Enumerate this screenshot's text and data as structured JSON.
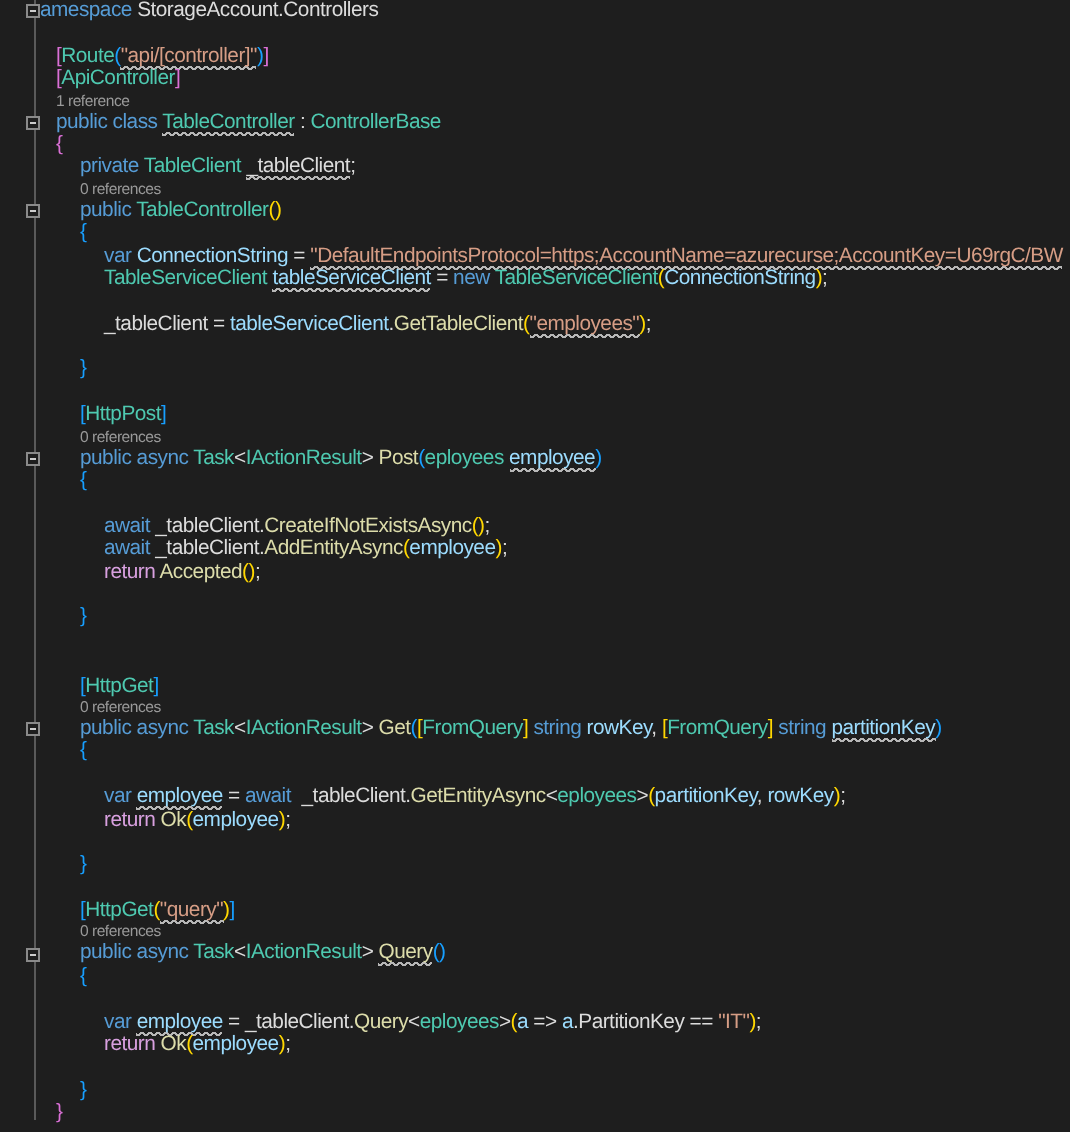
{
  "editor": {
    "lines": [
      {
        "kind": "code",
        "fold": true,
        "tokens": [
          {
            "text": "amespace",
            "kind": "keyword",
            "squiggle": false
          },
          {
            "text": " StorageAccount.Controllers",
            "kind": "plain",
            "squiggle": false
          }
        ],
        "children": [
          {
            "kind": "blank"
          },
          {
            "kind": "code",
            "fold": false,
            "tokens": [
              {
                "text": "[",
                "kind": "bracket2",
                "squiggle": false
              },
              {
                "text": "Route",
                "kind": "type",
                "squiggle": false
              },
              {
                "text": "(",
                "kind": "bracket3",
                "squiggle": false
              },
              {
                "text": "\"api/[controller]\"",
                "kind": "string",
                "squiggle": true
              },
              {
                "text": ")",
                "kind": "bracket3",
                "squiggle": false
              },
              {
                "text": "]",
                "kind": "bracket2",
                "squiggle": false
              }
            ]
          },
          {
            "kind": "code",
            "fold": false,
            "tokens": [
              {
                "text": "[",
                "kind": "bracket2",
                "squiggle": false
              },
              {
                "text": "ApiController",
                "kind": "type",
                "squiggle": false
              },
              {
                "text": "]",
                "kind": "bracket2",
                "squiggle": false
              }
            ]
          },
          {
            "kind": "lens",
            "text": "1 reference"
          },
          {
            "kind": "code",
            "fold": true,
            "tokens": [
              {
                "text": "public class ",
                "kind": "keyword",
                "squiggle": false
              },
              {
                "text": "TableController",
                "kind": "type",
                "squiggle": true
              },
              {
                "text": " : ",
                "kind": "plain",
                "squiggle": false
              },
              {
                "text": "ControllerBase",
                "kind": "type",
                "squiggle": false
              }
            ]
          },
          {
            "kind": "code",
            "fold": false,
            "tokens": [
              {
                "text": "{",
                "kind": "bracket2",
                "squiggle": false
              }
            ],
            "children": [
              {
                "kind": "code",
                "fold": false,
                "tokens": [
                  {
                    "text": "private ",
                    "kind": "keyword",
                    "squiggle": false
                  },
                  {
                    "text": "TableClient ",
                    "kind": "type",
                    "squiggle": false
                  },
                  {
                    "text": "_tableClient",
                    "kind": "plain",
                    "squiggle": true
                  },
                  {
                    "text": ";",
                    "kind": "plain",
                    "squiggle": false
                  }
                ]
              },
              {
                "kind": "lens",
                "text": "0 references"
              },
              {
                "kind": "code",
                "fold": true,
                "tokens": [
                  {
                    "text": "public ",
                    "kind": "keyword",
                    "squiggle": false
                  },
                  {
                    "text": "TableController",
                    "kind": "type",
                    "squiggle": false
                  },
                  {
                    "text": "()",
                    "kind": "bracket1",
                    "squiggle": false
                  }
                ]
              },
              {
                "kind": "code",
                "fold": false,
                "tokens": [
                  {
                    "text": "{",
                    "kind": "bracket3",
                    "squiggle": false
                  }
                ],
                "children": [
                  {
                    "kind": "code",
                    "fold": false,
                    "tokens": [
                      {
                        "text": "var ",
                        "kind": "keyword",
                        "squiggle": false
                      },
                      {
                        "text": "ConnectionString",
                        "kind": "variable",
                        "squiggle": false
                      },
                      {
                        "text": " = ",
                        "kind": "plain",
                        "squiggle": false
                      },
                      {
                        "text": "\"DefaultEndpointsProtocol=https;AccountName=azurecurse;AccountKey=U69rgC/BW",
                        "kind": "string",
                        "squiggle": true
                      }
                    ]
                  },
                  {
                    "kind": "code",
                    "fold": false,
                    "tokens": [
                      {
                        "text": "TableServiceClient ",
                        "kind": "type",
                        "squiggle": false
                      },
                      {
                        "text": "tableServiceClient",
                        "kind": "variable",
                        "squiggle": true
                      },
                      {
                        "text": " = ",
                        "kind": "plain",
                        "squiggle": false
                      },
                      {
                        "text": "new ",
                        "kind": "keyword",
                        "squiggle": false
                      },
                      {
                        "text": "TableServiceClient",
                        "kind": "type",
                        "squiggle": false
                      },
                      {
                        "text": "(",
                        "kind": "bracket1",
                        "squiggle": false
                      },
                      {
                        "text": "ConnectionString",
                        "kind": "variable",
                        "squiggle": false
                      },
                      {
                        "text": ")",
                        "kind": "bracket1",
                        "squiggle": false
                      },
                      {
                        "text": ";",
                        "kind": "plain",
                        "squiggle": false
                      }
                    ]
                  },
                  {
                    "kind": "blank"
                  },
                  {
                    "kind": "code",
                    "fold": false,
                    "tokens": [
                      {
                        "text": "_tableClient",
                        "kind": "plain",
                        "squiggle": false
                      },
                      {
                        "text": " = ",
                        "kind": "plain",
                        "squiggle": false
                      },
                      {
                        "text": "tableServiceClient",
                        "kind": "variable",
                        "squiggle": false
                      },
                      {
                        "text": ".",
                        "kind": "plain",
                        "squiggle": false
                      },
                      {
                        "text": "GetTableClient",
                        "kind": "method",
                        "squiggle": false
                      },
                      {
                        "text": "(",
                        "kind": "bracket1",
                        "squiggle": false
                      },
                      {
                        "text": "\"employees\"",
                        "kind": "string",
                        "squiggle": true
                      },
                      {
                        "text": ")",
                        "kind": "bracket1",
                        "squiggle": false
                      },
                      {
                        "text": ";",
                        "kind": "plain",
                        "squiggle": false
                      }
                    ]
                  },
                  {
                    "kind": "blank"
                  }
                ]
              },
              {
                "kind": "code",
                "fold": false,
                "tokens": [
                  {
                    "text": "}",
                    "kind": "bracket3",
                    "squiggle": false
                  }
                ]
              },
              {
                "kind": "blank"
              },
              {
                "kind": "code",
                "fold": false,
                "tokens": [
                  {
                    "text": "[",
                    "kind": "bracket3",
                    "squiggle": false
                  },
                  {
                    "text": "HttpPost",
                    "kind": "type",
                    "squiggle": false
                  },
                  {
                    "text": "]",
                    "kind": "bracket3",
                    "squiggle": false
                  }
                ]
              },
              {
                "kind": "lens",
                "text": "0 references"
              },
              {
                "kind": "code",
                "fold": true,
                "tokens": [
                  {
                    "text": "public async ",
                    "kind": "keyword",
                    "squiggle": false
                  },
                  {
                    "text": "Task",
                    "kind": "type",
                    "squiggle": false
                  },
                  {
                    "text": "<",
                    "kind": "plain",
                    "squiggle": false
                  },
                  {
                    "text": "IActionResult",
                    "kind": "type",
                    "squiggle": false
                  },
                  {
                    "text": "> ",
                    "kind": "plain",
                    "squiggle": false
                  },
                  {
                    "text": "Post",
                    "kind": "method",
                    "squiggle": false
                  },
                  {
                    "text": "(",
                    "kind": "bracket3",
                    "squiggle": false
                  },
                  {
                    "text": "eployees ",
                    "kind": "type",
                    "squiggle": false
                  },
                  {
                    "text": "employee",
                    "kind": "variable",
                    "squiggle": true
                  },
                  {
                    "text": ")",
                    "kind": "bracket3",
                    "squiggle": false
                  }
                ]
              },
              {
                "kind": "code",
                "fold": false,
                "tokens": [
                  {
                    "text": "{",
                    "kind": "bracket3",
                    "squiggle": false
                  }
                ],
                "children": [
                  {
                    "kind": "blank"
                  },
                  {
                    "kind": "code",
                    "fold": false,
                    "tokens": [
                      {
                        "text": "await ",
                        "kind": "keyword",
                        "squiggle": false
                      },
                      {
                        "text": "_tableClient.",
                        "kind": "plain",
                        "squiggle": false
                      },
                      {
                        "text": "CreateIfNotExistsAsync",
                        "kind": "method",
                        "squiggle": false
                      },
                      {
                        "text": "()",
                        "kind": "bracket1",
                        "squiggle": false
                      },
                      {
                        "text": ";",
                        "kind": "plain",
                        "squiggle": false
                      }
                    ]
                  },
                  {
                    "kind": "code",
                    "fold": false,
                    "tokens": [
                      {
                        "text": "await ",
                        "kind": "keyword",
                        "squiggle": false
                      },
                      {
                        "text": "_tableClient.",
                        "kind": "plain",
                        "squiggle": false
                      },
                      {
                        "text": "AddEntityAsync",
                        "kind": "method",
                        "squiggle": false
                      },
                      {
                        "text": "(",
                        "kind": "bracket1",
                        "squiggle": false
                      },
                      {
                        "text": "employee",
                        "kind": "variable",
                        "squiggle": false
                      },
                      {
                        "text": ")",
                        "kind": "bracket1",
                        "squiggle": false
                      },
                      {
                        "text": ";",
                        "kind": "plain",
                        "squiggle": false
                      }
                    ]
                  },
                  {
                    "kind": "code",
                    "fold": false,
                    "tokens": [
                      {
                        "text": "return ",
                        "kind": "control",
                        "squiggle": false
                      },
                      {
                        "text": "Accepted",
                        "kind": "method",
                        "squiggle": false
                      },
                      {
                        "text": "()",
                        "kind": "bracket1",
                        "squiggle": false
                      },
                      {
                        "text": ";",
                        "kind": "plain",
                        "squiggle": false
                      }
                    ]
                  },
                  {
                    "kind": "blank"
                  }
                ]
              },
              {
                "kind": "code",
                "fold": false,
                "tokens": [
                  {
                    "text": "}",
                    "kind": "bracket3",
                    "squiggle": false
                  }
                ]
              },
              {
                "kind": "blank"
              },
              {
                "kind": "blank"
              },
              {
                "kind": "code",
                "fold": false,
                "tokens": [
                  {
                    "text": "[",
                    "kind": "bracket3",
                    "squiggle": false
                  },
                  {
                    "text": "HttpGet",
                    "kind": "type",
                    "squiggle": false
                  },
                  {
                    "text": "]",
                    "kind": "bracket3",
                    "squiggle": false
                  }
                ]
              },
              {
                "kind": "lens",
                "text": "0 references"
              },
              {
                "kind": "code",
                "fold": true,
                "tokens": [
                  {
                    "text": "public async ",
                    "kind": "keyword",
                    "squiggle": false
                  },
                  {
                    "text": "Task",
                    "kind": "type",
                    "squiggle": false
                  },
                  {
                    "text": "<",
                    "kind": "plain",
                    "squiggle": false
                  },
                  {
                    "text": "IActionResult",
                    "kind": "type",
                    "squiggle": false
                  },
                  {
                    "text": "> ",
                    "kind": "plain",
                    "squiggle": false
                  },
                  {
                    "text": "Get",
                    "kind": "method",
                    "squiggle": false
                  },
                  {
                    "text": "(",
                    "kind": "bracket3",
                    "squiggle": false
                  },
                  {
                    "text": "[",
                    "kind": "bracket1",
                    "squiggle": false
                  },
                  {
                    "text": "FromQuery",
                    "kind": "type",
                    "squiggle": false
                  },
                  {
                    "text": "] ",
                    "kind": "bracket1",
                    "squiggle": false
                  },
                  {
                    "text": "string ",
                    "kind": "keyword",
                    "squiggle": false
                  },
                  {
                    "text": "rowKey",
                    "kind": "variable",
                    "squiggle": false
                  },
                  {
                    "text": ", ",
                    "kind": "plain",
                    "squiggle": false
                  },
                  {
                    "text": "[",
                    "kind": "bracket1",
                    "squiggle": false
                  },
                  {
                    "text": "FromQuery",
                    "kind": "type",
                    "squiggle": false
                  },
                  {
                    "text": "] ",
                    "kind": "bracket1",
                    "squiggle": false
                  },
                  {
                    "text": "string ",
                    "kind": "keyword",
                    "squiggle": false
                  },
                  {
                    "text": "partitionKey",
                    "kind": "variable",
                    "squiggle": true
                  },
                  {
                    "text": ")",
                    "kind": "bracket3",
                    "squiggle": false
                  }
                ]
              },
              {
                "kind": "code",
                "fold": false,
                "tokens": [
                  {
                    "text": "{",
                    "kind": "bracket3",
                    "squiggle": false
                  }
                ],
                "children": [
                  {
                    "kind": "blank"
                  },
                  {
                    "kind": "code",
                    "fold": false,
                    "tokens": [
                      {
                        "text": "var ",
                        "kind": "keyword",
                        "squiggle": false
                      },
                      {
                        "text": "employee",
                        "kind": "variable",
                        "squiggle": true
                      },
                      {
                        "text": " = ",
                        "kind": "plain",
                        "squiggle": false
                      },
                      {
                        "text": "await ",
                        "kind": "keyword",
                        "squiggle": false
                      },
                      {
                        "text": " _tableClient.",
                        "kind": "plain",
                        "squiggle": false
                      },
                      {
                        "text": "GetEntityAsync",
                        "kind": "method",
                        "squiggle": false
                      },
                      {
                        "text": "<",
                        "kind": "plain",
                        "squiggle": false
                      },
                      {
                        "text": "eployees",
                        "kind": "type",
                        "squiggle": false
                      },
                      {
                        "text": ">",
                        "kind": "plain",
                        "squiggle": false
                      },
                      {
                        "text": "(",
                        "kind": "bracket1",
                        "squiggle": false
                      },
                      {
                        "text": "partitionKey",
                        "kind": "variable",
                        "squiggle": false
                      },
                      {
                        "text": ", ",
                        "kind": "plain",
                        "squiggle": false
                      },
                      {
                        "text": "rowKey",
                        "kind": "variable",
                        "squiggle": false
                      },
                      {
                        "text": ")",
                        "kind": "bracket1",
                        "squiggle": false
                      },
                      {
                        "text": ";",
                        "kind": "plain",
                        "squiggle": false
                      }
                    ]
                  },
                  {
                    "kind": "code",
                    "fold": false,
                    "tokens": [
                      {
                        "text": "return ",
                        "kind": "control",
                        "squiggle": false
                      },
                      {
                        "text": "Ok",
                        "kind": "method",
                        "squiggle": false
                      },
                      {
                        "text": "(",
                        "kind": "bracket1",
                        "squiggle": false
                      },
                      {
                        "text": "employee",
                        "kind": "variable",
                        "squiggle": false
                      },
                      {
                        "text": ")",
                        "kind": "bracket1",
                        "squiggle": false
                      },
                      {
                        "text": ";",
                        "kind": "plain",
                        "squiggle": false
                      }
                    ]
                  },
                  {
                    "kind": "blank"
                  }
                ]
              },
              {
                "kind": "code",
                "fold": false,
                "tokens": [
                  {
                    "text": "}",
                    "kind": "bracket3",
                    "squiggle": false
                  }
                ]
              },
              {
                "kind": "blank"
              },
              {
                "kind": "code",
                "fold": false,
                "tokens": [
                  {
                    "text": "[",
                    "kind": "bracket3",
                    "squiggle": false
                  },
                  {
                    "text": "HttpGet",
                    "kind": "type",
                    "squiggle": false
                  },
                  {
                    "text": "(",
                    "kind": "bracket1",
                    "squiggle": false
                  },
                  {
                    "text": "\"query\"",
                    "kind": "string",
                    "squiggle": true
                  },
                  {
                    "text": ")",
                    "kind": "bracket1",
                    "squiggle": false
                  },
                  {
                    "text": "]",
                    "kind": "bracket3",
                    "squiggle": false
                  }
                ]
              },
              {
                "kind": "lens",
                "text": "0 references"
              },
              {
                "kind": "code",
                "fold": true,
                "tokens": [
                  {
                    "text": "public async ",
                    "kind": "keyword",
                    "squiggle": false
                  },
                  {
                    "text": "Task",
                    "kind": "type",
                    "squiggle": false
                  },
                  {
                    "text": "<",
                    "kind": "plain",
                    "squiggle": false
                  },
                  {
                    "text": "IActionResult",
                    "kind": "type",
                    "squiggle": false
                  },
                  {
                    "text": "> ",
                    "kind": "plain",
                    "squiggle": false
                  },
                  {
                    "text": "Query",
                    "kind": "method",
                    "squiggle": true
                  },
                  {
                    "text": "()",
                    "kind": "bracket3",
                    "squiggle": false
                  }
                ]
              },
              {
                "kind": "code",
                "fold": false,
                "tokens": [
                  {
                    "text": "{",
                    "kind": "bracket3",
                    "squiggle": false
                  }
                ],
                "children": [
                  {
                    "kind": "blank"
                  },
                  {
                    "kind": "code",
                    "fold": false,
                    "tokens": [
                      {
                        "text": "var ",
                        "kind": "keyword",
                        "squiggle": false
                      },
                      {
                        "text": "employee",
                        "kind": "variable",
                        "squiggle": true
                      },
                      {
                        "text": " = ",
                        "kind": "plain",
                        "squiggle": false
                      },
                      {
                        "text": "_tableClient.",
                        "kind": "plain",
                        "squiggle": false
                      },
                      {
                        "text": "Query",
                        "kind": "method",
                        "squiggle": false
                      },
                      {
                        "text": "<",
                        "kind": "plain",
                        "squiggle": false
                      },
                      {
                        "text": "eployees",
                        "kind": "type",
                        "squiggle": false
                      },
                      {
                        "text": ">",
                        "kind": "plain",
                        "squiggle": false
                      },
                      {
                        "text": "(",
                        "kind": "bracket1",
                        "squiggle": false
                      },
                      {
                        "text": "a",
                        "kind": "variable",
                        "squiggle": false
                      },
                      {
                        "text": " => ",
                        "kind": "plain",
                        "squiggle": false
                      },
                      {
                        "text": "a",
                        "kind": "variable",
                        "squiggle": false
                      },
                      {
                        "text": ".PartitionKey == ",
                        "kind": "plain",
                        "squiggle": false
                      },
                      {
                        "text": "\"IT\"",
                        "kind": "string",
                        "squiggle": false
                      },
                      {
                        "text": ")",
                        "kind": "bracket1",
                        "squiggle": false
                      },
                      {
                        "text": ";",
                        "kind": "plain",
                        "squiggle": false
                      }
                    ]
                  },
                  {
                    "kind": "code",
                    "fold": false,
                    "tokens": [
                      {
                        "text": "return ",
                        "kind": "control",
                        "squiggle": false
                      },
                      {
                        "text": "Ok",
                        "kind": "method",
                        "squiggle": false
                      },
                      {
                        "text": "(",
                        "kind": "bracket1",
                        "squiggle": false
                      },
                      {
                        "text": "employee",
                        "kind": "variable",
                        "squiggle": false
                      },
                      {
                        "text": ")",
                        "kind": "bracket1",
                        "squiggle": false
                      },
                      {
                        "text": ";",
                        "kind": "plain",
                        "squiggle": false
                      }
                    ]
                  },
                  {
                    "kind": "blank"
                  }
                ]
              },
              {
                "kind": "code",
                "fold": false,
                "tokens": [
                  {
                    "text": "}",
                    "kind": "bracket3",
                    "squiggle": false
                  }
                ]
              }
            ]
          },
          {
            "kind": "code",
            "fold": false,
            "tokens": [
              {
                "text": "}",
                "kind": "bracket2",
                "squiggle": false
              }
            ]
          }
        ]
      }
    ]
  }
}
